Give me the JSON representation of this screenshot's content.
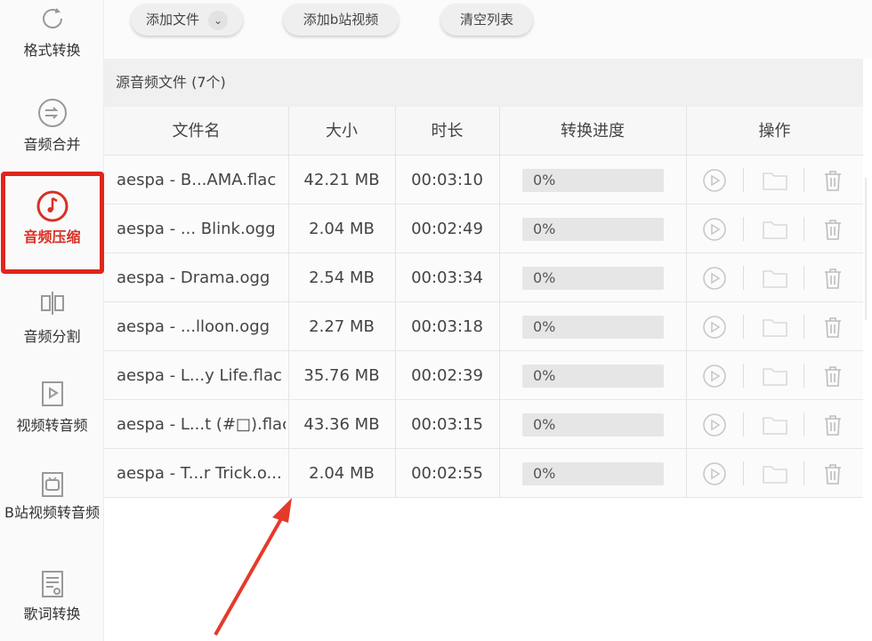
{
  "sidebar": {
    "items": [
      {
        "label": "格式转换",
        "icon": "refresh-icon"
      },
      {
        "label": "音频合并",
        "icon": "merge-icon"
      },
      {
        "label": "音频压缩",
        "icon": "music-note-icon"
      },
      {
        "label": "音频分割",
        "icon": "split-icon"
      },
      {
        "label": "视频转音频",
        "icon": "video-audio-icon"
      },
      {
        "label": "B站视频转音频",
        "icon": "bilibili-tv-icon"
      },
      {
        "label": "歌词转换",
        "icon": "lyrics-icon"
      }
    ],
    "active_color": "#e0261c"
  },
  "toolbar": {
    "add_file": "添加文件",
    "add_bili": "添加b站视频",
    "clear": "清空列表"
  },
  "panel": {
    "title": "源音频文件 (7个)"
  },
  "table": {
    "columns": [
      "文件名",
      "大小",
      "时长",
      "转换进度",
      "操作"
    ],
    "rows": [
      {
        "name": "aespa - B...AMA.flac",
        "size": "42.21 MB",
        "duration": "00:03:10",
        "progress": "0%"
      },
      {
        "name": "aespa - ... Blink.ogg",
        "size": "2.04 MB",
        "duration": "00:02:49",
        "progress": "0%"
      },
      {
        "name": "aespa - Drama.ogg",
        "size": "2.54 MB",
        "duration": "00:03:34",
        "progress": "0%"
      },
      {
        "name": "aespa - ...lloon.ogg",
        "size": "2.27 MB",
        "duration": "00:03:18",
        "progress": "0%"
      },
      {
        "name": "aespa - L...y Life.flac",
        "size": "35.76 MB",
        "duration": "00:02:39",
        "progress": "0%"
      },
      {
        "name": "aespa - L...t (#□).flac",
        "size": "43.36 MB",
        "duration": "00:03:15",
        "progress": "0%"
      },
      {
        "name": "aespa - T...r Trick.o...",
        "size": "2.04 MB",
        "duration": "00:02:55",
        "progress": "0%"
      }
    ],
    "ops": [
      "play-icon",
      "folder-icon",
      "trash-icon"
    ]
  },
  "annotation": {
    "arrow_color": "#e53a2a"
  }
}
